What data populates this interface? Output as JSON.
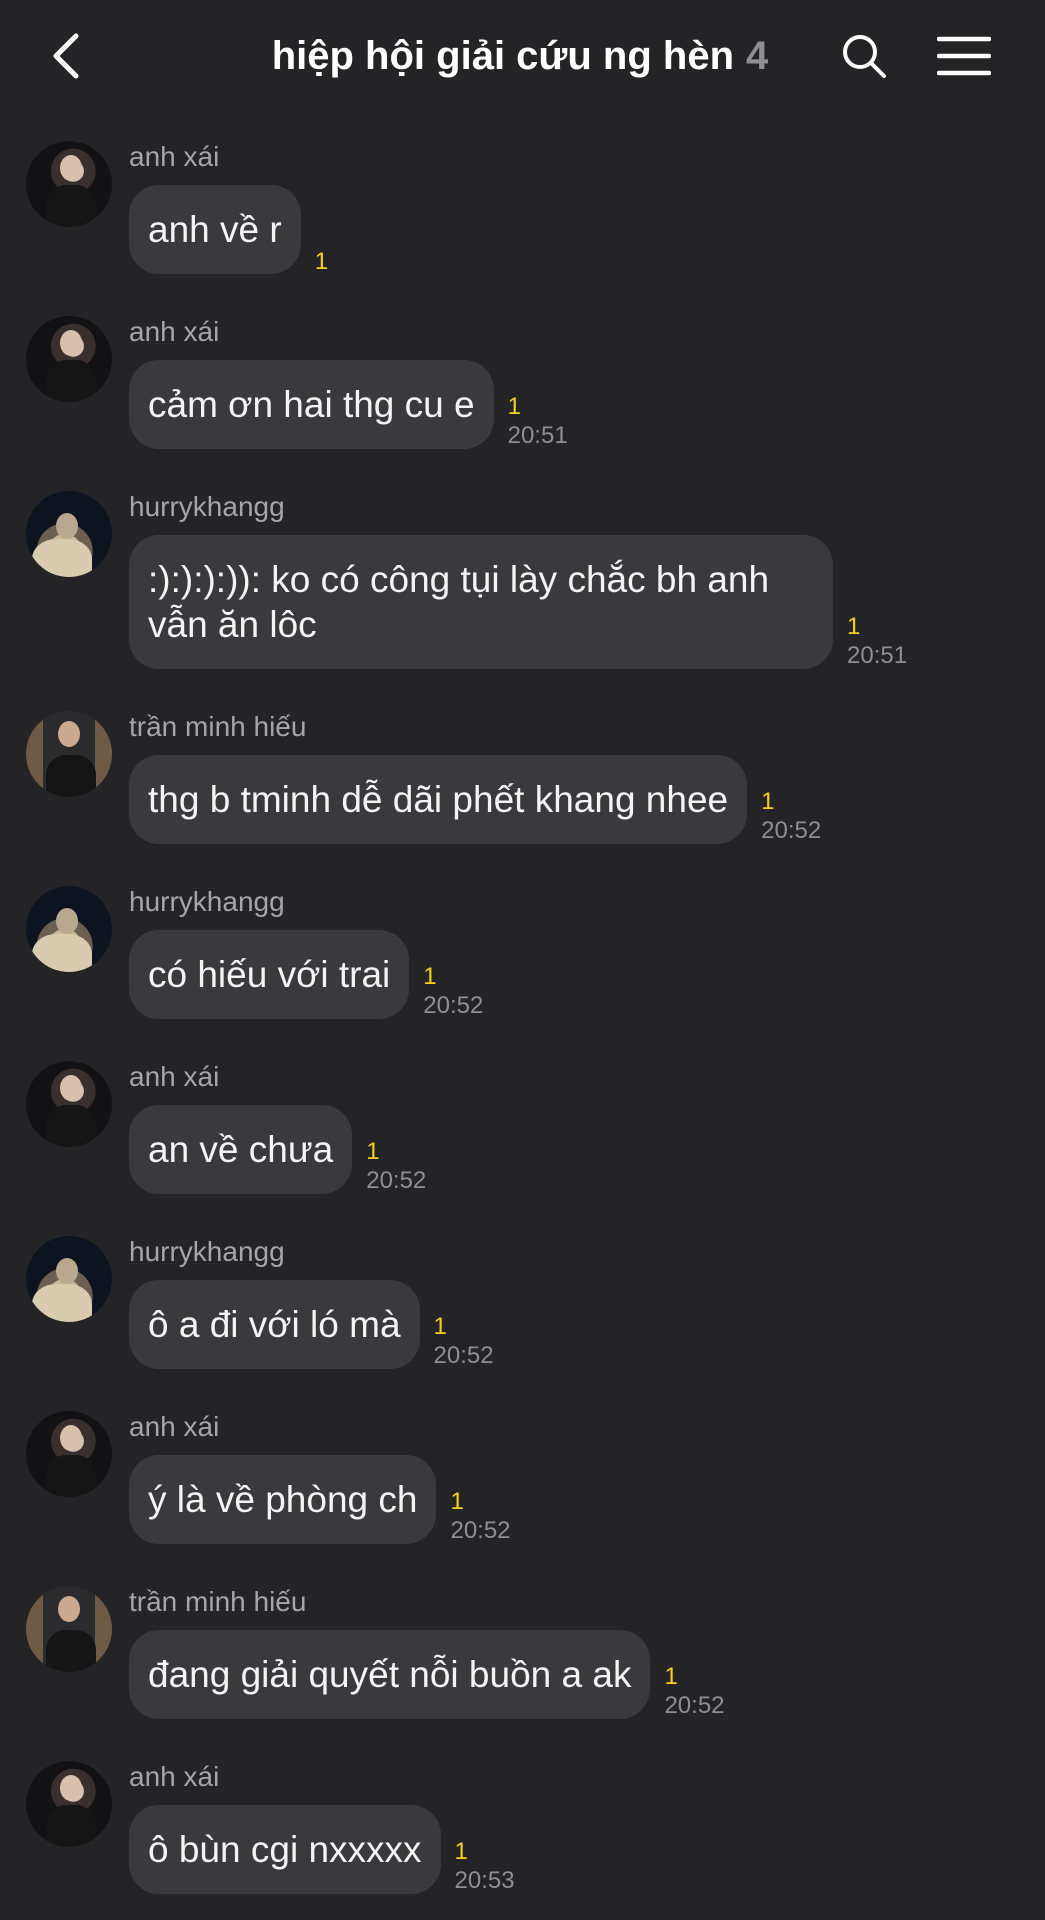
{
  "header": {
    "title": "hiệp hội giải cứu ng hèn",
    "member_count": "4"
  },
  "messages": [
    {
      "sender": "anh xái",
      "avatar": "avatar-anh-xai",
      "text": "anh về r",
      "unread": "1",
      "time": ""
    },
    {
      "sender": "anh xái",
      "avatar": "avatar-anh-xai",
      "text": "cảm ơn hai thg cu e",
      "unread": "1",
      "time": "20:51"
    },
    {
      "sender": "hurrykhangg",
      "avatar": "avatar-hurrykhangg",
      "text": ":):):):)): ko có công tụi lày chắc bh anh vẫn ăn lôc",
      "unread": "1",
      "time": "20:51"
    },
    {
      "sender": "trần minh hiếu",
      "avatar": "avatar-tran-minh-hieu",
      "text": "thg b tminh dễ dãi phết khang nhee",
      "unread": "1",
      "time": "20:52"
    },
    {
      "sender": "hurrykhangg",
      "avatar": "avatar-hurrykhangg",
      "text": "có hiếu với trai",
      "unread": "1",
      "time": "20:52"
    },
    {
      "sender": "anh xái",
      "avatar": "avatar-anh-xai",
      "text": "an về chưa",
      "unread": "1",
      "time": "20:52"
    },
    {
      "sender": "hurrykhangg",
      "avatar": "avatar-hurrykhangg",
      "text": "ô a đi với ló mà",
      "unread": "1",
      "time": "20:52"
    },
    {
      "sender": "anh xái",
      "avatar": "avatar-anh-xai",
      "text": "ý là về phòng ch",
      "unread": "1",
      "time": "20:52"
    },
    {
      "sender": "trần minh hiếu",
      "avatar": "avatar-tran-minh-hieu",
      "text": "đang giải quyết nỗi buồn a ak",
      "unread": "1",
      "time": "20:52"
    },
    {
      "sender": "anh xái",
      "avatar": "avatar-anh-xai",
      "text": "ô bùn cgi nxxxxx",
      "unread": "1",
      "time": "20:53"
    }
  ],
  "colors": {
    "background": "#242427",
    "bubble": "#3a3a3d",
    "unread": "#f5d020",
    "timestamp": "#8e8e93",
    "sender": "#a5a5aa"
  },
  "icons": {
    "back": "chevron-left-icon",
    "search": "search-icon",
    "menu": "hamburger-menu-icon"
  }
}
